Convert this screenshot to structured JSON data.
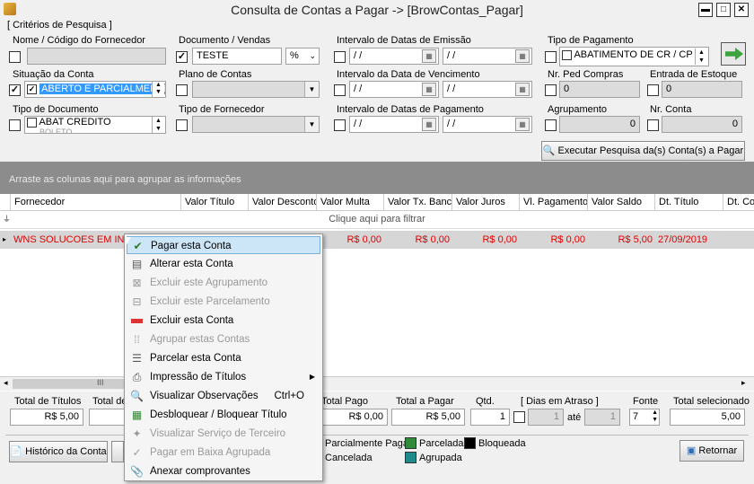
{
  "window": {
    "title": "Consulta de Contas a Pagar   ->   [BrowContas_Pagar]"
  },
  "criteria": {
    "group_title": "[ Critérios de Pesquisa ]",
    "fornecedor_label": "Nome / Código do Fornecedor",
    "documento_label": "Documento / Vendas",
    "documento_value": "TESTE",
    "documento_op": "%",
    "emissao_label": "Intervalo de Datas de Emissão",
    "date_placeholder": " /  /",
    "tipo_pagamento_label": "Tipo de Pagamento",
    "tipo_pagamento_value": "ABATIMENTO DE CR / CP",
    "situacao_label": "Situação da Conta",
    "situacao_value": "ABERTO E PARCIALMENTE PA",
    "plano_label": "Plano de Contas",
    "vencimento_label": "Intervalo da Data de Vencimento",
    "nr_ped_label": "Nr. Ped Compras",
    "nr_ped_value": "0",
    "entrada_label": "Entrada de Estoque",
    "entrada_value": "0",
    "tipo_doc_label": "Tipo de Documento",
    "tipo_doc_value1": "ABAT CREDITO",
    "tipo_doc_value2": "BOLETO",
    "tipo_fornecedor_label": "Tipo de Fornecedor",
    "pagamento_label": "Intervalo de Datas de Pagamento",
    "agrupamento_label": "Agrupamento",
    "agrupamento_value": "0",
    "nr_conta_label": "Nr. Conta",
    "nr_conta_value": "0",
    "executar_label": "Executar Pesquisa da(s) Conta(s) a Pagar"
  },
  "grid": {
    "group_hint": "Arraste as colunas aqui para agrupar as informações",
    "filter_hint": "Clique aqui para filtrar",
    "columns": [
      "Fornecedor",
      "Valor Título",
      "Valor Desconto",
      "Valor Multa",
      "Valor Tx. Banc",
      "Valor Juros",
      "Vl. Pagamento",
      "Valor Saldo",
      "Dt. Título",
      "Dt. Co"
    ],
    "row": {
      "fornecedor": "WNS SOLUCOES EM INFOR",
      "multa": "R$ 0,00",
      "tx": "R$ 0,00",
      "juros": "R$ 0,00",
      "pagamento": "R$ 0,00",
      "saldo": "R$ 5,00",
      "dt": "27/09/2019"
    },
    "scroll_mid": "III"
  },
  "context_menu": [
    {
      "label": "Pagar esta Conta",
      "icon": "pay-icon",
      "enabled": true
    },
    {
      "label": "Alterar esta Conta",
      "icon": "edit-icon",
      "enabled": true
    },
    {
      "label": "Excluir este Agrupamento",
      "icon": "delete-group-icon",
      "enabled": false
    },
    {
      "label": "Excluir este Parcelamento",
      "icon": "delete-installment-icon",
      "enabled": false
    },
    {
      "label": "Excluir esta Conta",
      "icon": "delete-icon",
      "enabled": true
    },
    {
      "label": "Agrupar estas Contas",
      "icon": "group-icon",
      "enabled": false
    },
    {
      "label": "Parcelar esta Conta",
      "icon": "installment-icon",
      "enabled": true
    },
    {
      "label": "Impressão de Títulos",
      "icon": "print-icon",
      "enabled": true
    },
    {
      "label": "Visualizar Observações",
      "icon": "notes-icon",
      "enabled": true,
      "shortcut": "Ctrl+O"
    },
    {
      "label": "Desbloquear / Bloquear Título",
      "icon": "lock-icon",
      "enabled": true
    },
    {
      "label": "Visualizar Serviço de Terceiro",
      "icon": "service-icon",
      "enabled": false
    },
    {
      "label": "Pagar em Baixa Agrupada",
      "icon": "pay-group-icon",
      "enabled": false
    },
    {
      "label": "Anexar comprovantes",
      "icon": "attach-icon",
      "enabled": true
    }
  ],
  "totals": {
    "titulos_label": "Total de Títulos",
    "titulos_value": "R$ 5,00",
    "desc_label": "Total de",
    "pago_label": "Total Pago",
    "pago_value": "R$ 0,00",
    "apagar_label": "Total a Pagar",
    "apagar_value": "R$ 5,00",
    "qtd_label": "Qtd.",
    "qtd_value": "1",
    "dias_label": "[ Dias em Atraso ]",
    "dias_from": "1",
    "ate": "até",
    "dias_to": "1",
    "fonte_label": "Fonte",
    "fonte_value": "7",
    "sel_label": "Total selecionado",
    "sel_value": "5,00"
  },
  "footer": {
    "historico_label": "Histórico da Conta",
    "retornar_label": "Retornar",
    "legend": {
      "parcial": "Parcialmente Paga",
      "parcelada": "Parcelada",
      "bloqueada": "Bloqueada",
      "cancelada": "Cancelada",
      "agrupada": "Agrupada"
    },
    "colors": {
      "parcelada": "#2e8b3a",
      "bloqueada": "#000000",
      "agrupada": "#1f8a8a"
    }
  }
}
